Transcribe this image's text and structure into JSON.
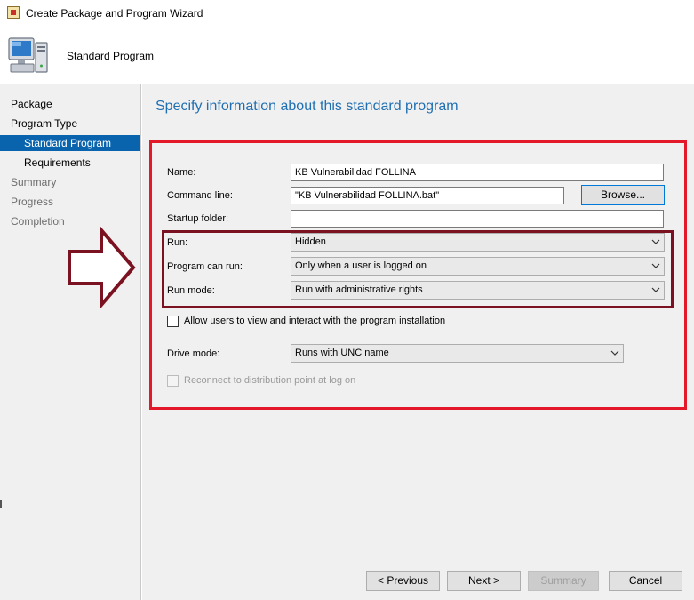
{
  "window": {
    "title": "Create Package and Program Wizard"
  },
  "header": {
    "title": "Standard Program",
    "icon": "computer-icon"
  },
  "sidebar": {
    "items": [
      {
        "label": "Package",
        "state": "done"
      },
      {
        "label": "Program Type",
        "state": "done"
      },
      {
        "label": "Standard Program",
        "state": "active"
      },
      {
        "label": "Requirements",
        "state": "done"
      },
      {
        "label": "Summary",
        "state": "future"
      },
      {
        "label": "Progress",
        "state": "future"
      },
      {
        "label": "Completion",
        "state": "future"
      }
    ]
  },
  "main": {
    "heading": "Specify information about this standard program",
    "fields": {
      "name": {
        "label": "Name:",
        "value": "KB Vulnerabilidad FOLLINA"
      },
      "command_line": {
        "label": "Command line:",
        "value": "\"KB Vulnerabilidad FOLLINA.bat\""
      },
      "browse_label": "Browse...",
      "startup_folder": {
        "label": "Startup folder:",
        "value": ""
      },
      "run": {
        "label": "Run:",
        "value": "Hidden"
      },
      "program_can_run": {
        "label": "Program can run:",
        "value": "Only when a user is logged on"
      },
      "run_mode": {
        "label": "Run mode:",
        "value": "Run with administrative rights"
      },
      "allow_interact": {
        "label": "Allow users to view and interact with the program installation",
        "checked": false
      },
      "drive_mode": {
        "label": "Drive mode:",
        "value": "Runs with UNC name"
      },
      "reconnect": {
        "label": "Reconnect to distribution point at log on",
        "checked": false,
        "enabled": false
      }
    }
  },
  "footer": {
    "previous": "< Previous",
    "next": "Next >",
    "summary": "Summary",
    "cancel": "Cancel"
  },
  "colors": {
    "accent": "#0a64ad",
    "heading": "#1f6fb2",
    "highlight_box": "#e3192a",
    "highlight_inner_box": "#7b1222",
    "arrow": "#7b1222"
  }
}
